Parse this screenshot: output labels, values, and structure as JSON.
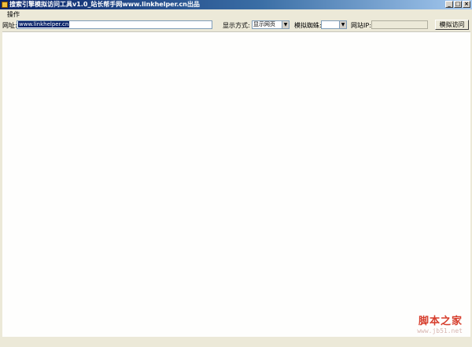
{
  "window": {
    "title": "搜索引擎模拟访问工具v1.0_站长帮手网www.linkhelper.cn出品",
    "buttons": {
      "minimize": "_",
      "maximize": "□",
      "close": "×"
    }
  },
  "menu": {
    "items": [
      {
        "label": "操作"
      }
    ]
  },
  "toolbar": {
    "url_label": "网址:",
    "url_value": "www.linkhelper.cn",
    "display_label": "显示方式:",
    "display_value": "显示网页",
    "engine_label": "模拟蜘蛛:",
    "engine_value": "",
    "ip_label": "网站IP:",
    "ip_value": "",
    "visit_button": "模拟访问"
  },
  "watermark": {
    "title": "脚本之家",
    "url": "www.jb51.net"
  }
}
